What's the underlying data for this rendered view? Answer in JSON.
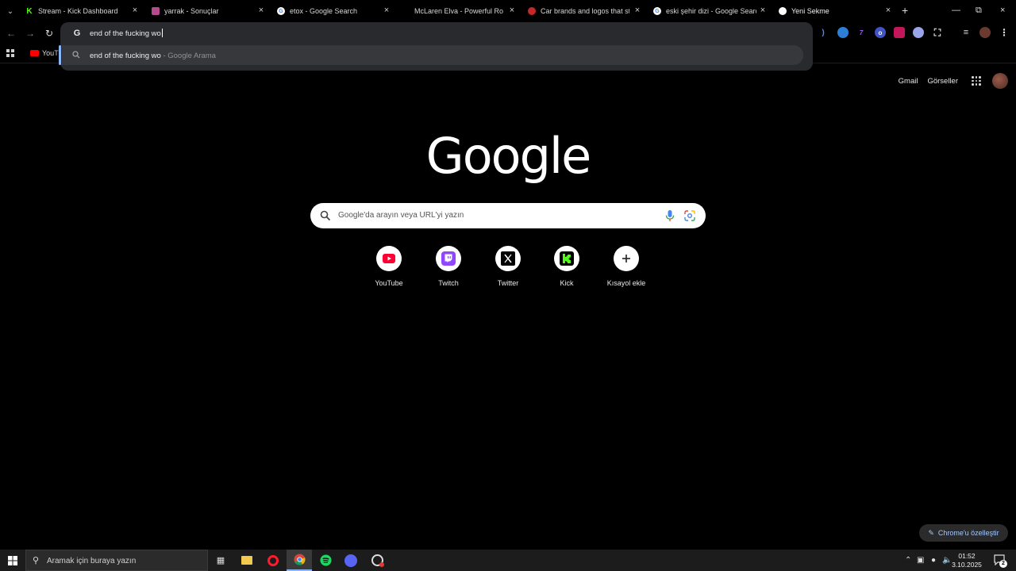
{
  "tabs": [
    {
      "title": "Stream - Kick Dashboard",
      "icon": "kick-icon",
      "color": "#53fc18"
    },
    {
      "title": "yarrak - Sonuçlar",
      "icon": "site-icon",
      "color": "#b44b8c"
    },
    {
      "title": "etox - Google Search",
      "icon": "google-icon",
      "color": "#ffffff"
    },
    {
      "title": "McLaren Elva - Powerful Roadst",
      "icon": "mclaren-icon",
      "color": "#000000"
    },
    {
      "title": "Car brands and logos that start",
      "icon": "globe-icon",
      "color": "#c62828"
    },
    {
      "title": "eski şehir dizi - Google Search",
      "icon": "google-icon",
      "color": "#ffffff"
    },
    {
      "title": "Yeni Sekme",
      "icon": "chrome-icon",
      "color": "#ffffff"
    }
  ],
  "omnibox": {
    "input": "end of the fucking wo",
    "suggestion_main": "end of the fucking wo",
    "suggestion_sub": "- Google Arama"
  },
  "bookmarks": {
    "youtube_label": "YouTu"
  },
  "header": {
    "gmail": "Gmail",
    "images": "Görseller"
  },
  "logo": "Google",
  "search": {
    "placeholder": "Google'da arayın veya URL'yi yazın"
  },
  "shortcuts": [
    {
      "label": "YouTube",
      "icon": "youtube-icon"
    },
    {
      "label": "Twitch",
      "icon": "twitch-icon"
    },
    {
      "label": "Twitter",
      "icon": "x-icon"
    },
    {
      "label": "Kick",
      "icon": "kick-icon"
    },
    {
      "label": "Kısayol ekle",
      "icon": "plus-icon"
    }
  ],
  "customize_label": "Chrome'u özelleştir",
  "taskbar": {
    "search_placeholder": "Aramak için buraya yazın",
    "time": "01:52",
    "date": "3.10.2025",
    "notification_count": "2"
  },
  "colors": {
    "accent": "#8ab4f8",
    "omnibox_bg": "#282a2d",
    "page_bg": "#000000"
  }
}
